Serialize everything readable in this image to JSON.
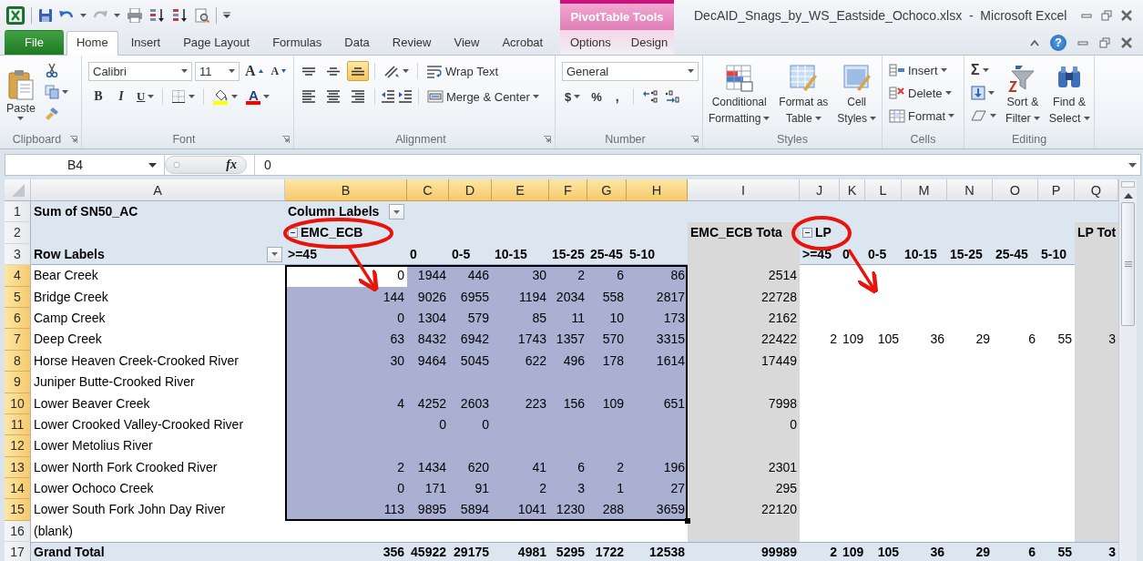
{
  "window": {
    "title": "DecAID_Snags_by_WS_Eastside_Ochoco.xlsx  -  Microsoft Excel",
    "contextual_tab_group": "PivotTable Tools",
    "help": "?"
  },
  "tabs": [
    {
      "label": "File",
      "kind": "file",
      "selected": false
    },
    {
      "label": "Home",
      "kind": "standard",
      "selected": true
    },
    {
      "label": "Insert",
      "kind": "standard",
      "selected": false
    },
    {
      "label": "Page Layout",
      "kind": "standard",
      "selected": false
    },
    {
      "label": "Formulas",
      "kind": "standard",
      "selected": false
    },
    {
      "label": "Data",
      "kind": "standard",
      "selected": false
    },
    {
      "label": "Review",
      "kind": "standard",
      "selected": false
    },
    {
      "label": "View",
      "kind": "standard",
      "selected": false
    },
    {
      "label": "Acrobat",
      "kind": "standard",
      "selected": false
    },
    {
      "label": "Options",
      "kind": "contextual",
      "selected": false
    },
    {
      "label": "Design",
      "kind": "contextual",
      "selected": false
    }
  ],
  "ribbon": {
    "clipboard": {
      "label": "Clipboard",
      "paste": "Paste"
    },
    "font": {
      "label": "Font",
      "font_name": "Calibri",
      "font_size": "11",
      "grow": "A",
      "shrink": "A",
      "bold": "B",
      "italic": "I",
      "underline": "U",
      "font_color": "A"
    },
    "alignment": {
      "label": "Alignment",
      "vertical_buttons": [
        {
          "kind": "top",
          "selected": false
        },
        {
          "kind": "middle",
          "selected": false
        },
        {
          "kind": "bottom",
          "selected": true
        }
      ],
      "wrap_text": "Wrap Text",
      "merge": "Merge & Center"
    },
    "number": {
      "label": "Number",
      "format": "General",
      "currency": "$",
      "percent": "%",
      "comma": ","
    },
    "styles": {
      "label": "Styles",
      "buttons": [
        {
          "kind": "conditional",
          "lines": [
            "Conditional",
            "Formatting"
          ]
        },
        {
          "kind": "table",
          "lines": [
            "Format as",
            "Table"
          ]
        },
        {
          "kind": "cell",
          "lines": [
            "Cell",
            "Styles"
          ]
        }
      ]
    },
    "cells": {
      "label": "Cells",
      "buttons": [
        {
          "kind": "insert",
          "label": "Insert"
        },
        {
          "kind": "delete",
          "label": "Delete"
        },
        {
          "kind": "format",
          "label": "Format"
        }
      ]
    },
    "editing": {
      "label": "Editing",
      "autosum": "Σ",
      "buttons": [
        {
          "kind": "sort",
          "lines": [
            "Sort &",
            "Filter"
          ]
        },
        {
          "kind": "find",
          "lines": [
            "Find &",
            "Select"
          ]
        }
      ]
    }
  },
  "formula_bar": {
    "name_box": "B4",
    "function_label": "fx",
    "value": "0"
  },
  "sheet": {
    "column_letters": [
      "A",
      "B",
      "C",
      "D",
      "E",
      "F",
      "G",
      "H",
      "I",
      "J",
      "K",
      "L",
      "M",
      "N",
      "O",
      "P",
      "Q"
    ],
    "header_row_numbers": [
      "1",
      "2",
      "3"
    ],
    "pivot": {
      "value_label": "Sum of SN50_AC",
      "column_labels": "Column Labels",
      "row_labels": "Row Labels",
      "groups": [
        {
          "name": "EMC_ECB",
          "expanded": true,
          "selected": true,
          "circled": true,
          "total_label": "EMC_ECB Tota",
          "subcolumns": [
            ">=45",
            "0",
            "0-5",
            "10-15",
            "15-25",
            "25-45",
            "5-10"
          ]
        },
        {
          "name": "LP",
          "expanded": true,
          "selected": false,
          "circled": true,
          "total_label": "LP Tot",
          "subcolumns": [
            ">=45",
            "0",
            "0-5",
            "10-15",
            "15-25",
            "25-45",
            "5-10"
          ]
        }
      ],
      "rows": [
        {
          "number": "4",
          "label": "Bear Creek",
          "selected": true,
          "cells": {
            "B": "0",
            "C": "1944",
            "D": "446",
            "E": "30",
            "F": "2",
            "G": "6",
            "H": "86",
            "I": "2514"
          }
        },
        {
          "number": "5",
          "label": "Bridge Creek",
          "selected": true,
          "cells": {
            "B": "144",
            "C": "9026",
            "D": "6955",
            "E": "1194",
            "F": "2034",
            "G": "558",
            "H": "2817",
            "I": "22728"
          }
        },
        {
          "number": "6",
          "label": "Camp Creek",
          "selected": true,
          "cells": {
            "B": "0",
            "C": "1304",
            "D": "579",
            "E": "85",
            "F": "11",
            "G": "10",
            "H": "173",
            "I": "2162"
          }
        },
        {
          "number": "7",
          "label": "Deep Creek",
          "selected": true,
          "cells": {
            "B": "63",
            "C": "8432",
            "D": "6942",
            "E": "1743",
            "F": "1357",
            "G": "570",
            "H": "3315",
            "I": "22422",
            "J": "2",
            "K": "109",
            "L": "105",
            "M": "36",
            "N": "29",
            "O": "6",
            "P": "55",
            "Q": "3"
          }
        },
        {
          "number": "8",
          "label": "Horse Heaven Creek-Crooked River",
          "selected": true,
          "cells": {
            "B": "30",
            "C": "9464",
            "D": "5045",
            "E": "622",
            "F": "496",
            "G": "178",
            "H": "1614",
            "I": "17449"
          }
        },
        {
          "number": "9",
          "label": "Juniper Butte-Crooked River",
          "selected": true
        },
        {
          "number": "10",
          "label": "Lower Beaver Creek",
          "selected": true,
          "cells": {
            "B": "4",
            "C": "4252",
            "D": "2603",
            "E": "223",
            "F": "156",
            "G": "109",
            "H": "651",
            "I": "7998"
          }
        },
        {
          "number": "11",
          "label": "Lower Crooked Valley-Crooked River",
          "selected": true,
          "cells": {
            "C": "0",
            "D": "0",
            "I": "0"
          }
        },
        {
          "number": "12",
          "label": "Lower Metolius River",
          "selected": true
        },
        {
          "number": "13",
          "label": "Lower North Fork Crooked River",
          "selected": true,
          "cells": {
            "B": "2",
            "C": "1434",
            "D": "620",
            "E": "41",
            "F": "6",
            "G": "2",
            "H": "196",
            "I": "2301"
          }
        },
        {
          "number": "14",
          "label": "Lower Ochoco Creek",
          "selected": true,
          "cells": {
            "B": "0",
            "C": "171",
            "D": "91",
            "E": "2",
            "F": "3",
            "G": "1",
            "H": "27",
            "I": "295"
          }
        },
        {
          "number": "15",
          "label": "Lower South Fork John Day River",
          "selected": true,
          "cells": {
            "B": "113",
            "C": "9895",
            "D": "5894",
            "E": "1041",
            "F": "1230",
            "G": "288",
            "H": "3659",
            "I": "22120"
          }
        },
        {
          "number": "16",
          "label": "(blank)",
          "selected": false
        }
      ],
      "grand_total": {
        "number": "17",
        "label": "Grand Total",
        "cells": {
          "B": "356",
          "C": "45922",
          "D": "29175",
          "E": "4981",
          "F": "5295",
          "G": "1722",
          "H": "12538",
          "I": "99989",
          "J": "2",
          "K": "109",
          "L": "105",
          "M": "36",
          "N": "29",
          "O": "6",
          "P": "55",
          "Q": "3"
        }
      }
    }
  }
}
